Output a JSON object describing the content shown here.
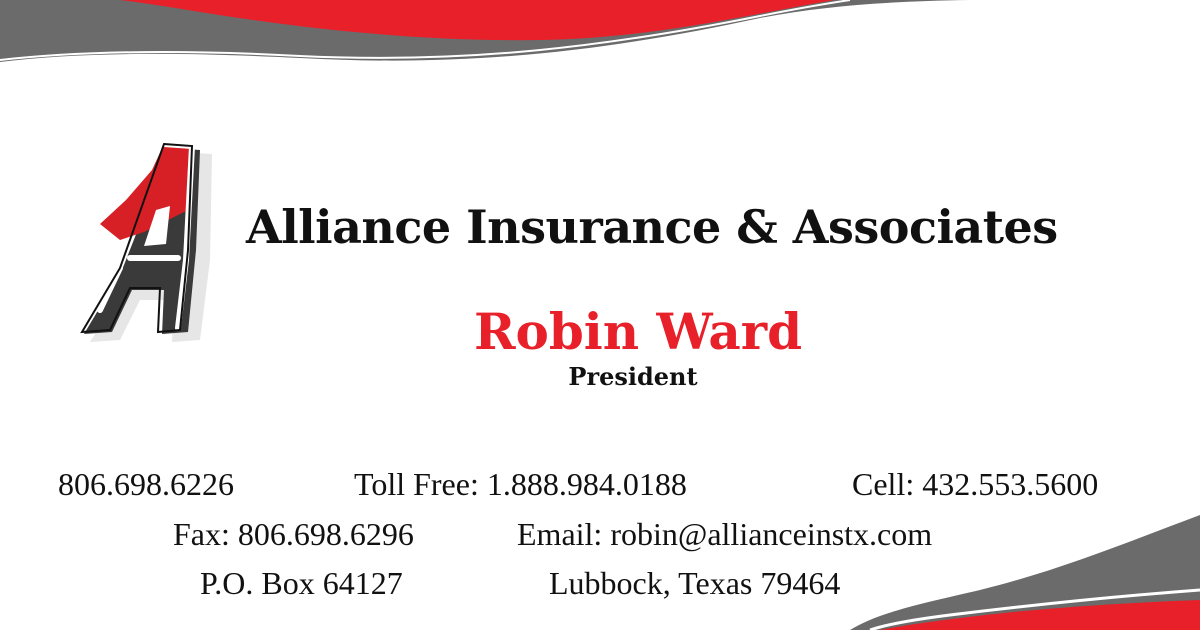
{
  "brand": {
    "company_name": "Alliance Insurance & Associates",
    "logo_letter": "A",
    "accent_red": "#e8202a",
    "accent_gray": "#6b6b6b"
  },
  "person": {
    "name": "Robin Ward",
    "title": "President"
  },
  "contact": {
    "phone": "806.698.6226",
    "toll_free": "Toll Free: 1.888.984.0188",
    "cell": "Cell: 432.553.5600",
    "fax": "Fax: 806.698.6296",
    "email": "Email: robin@allianceinstx.com",
    "po_box": "P.O. Box 64127",
    "city_state_zip": "Lubbock, Texas 79464"
  }
}
